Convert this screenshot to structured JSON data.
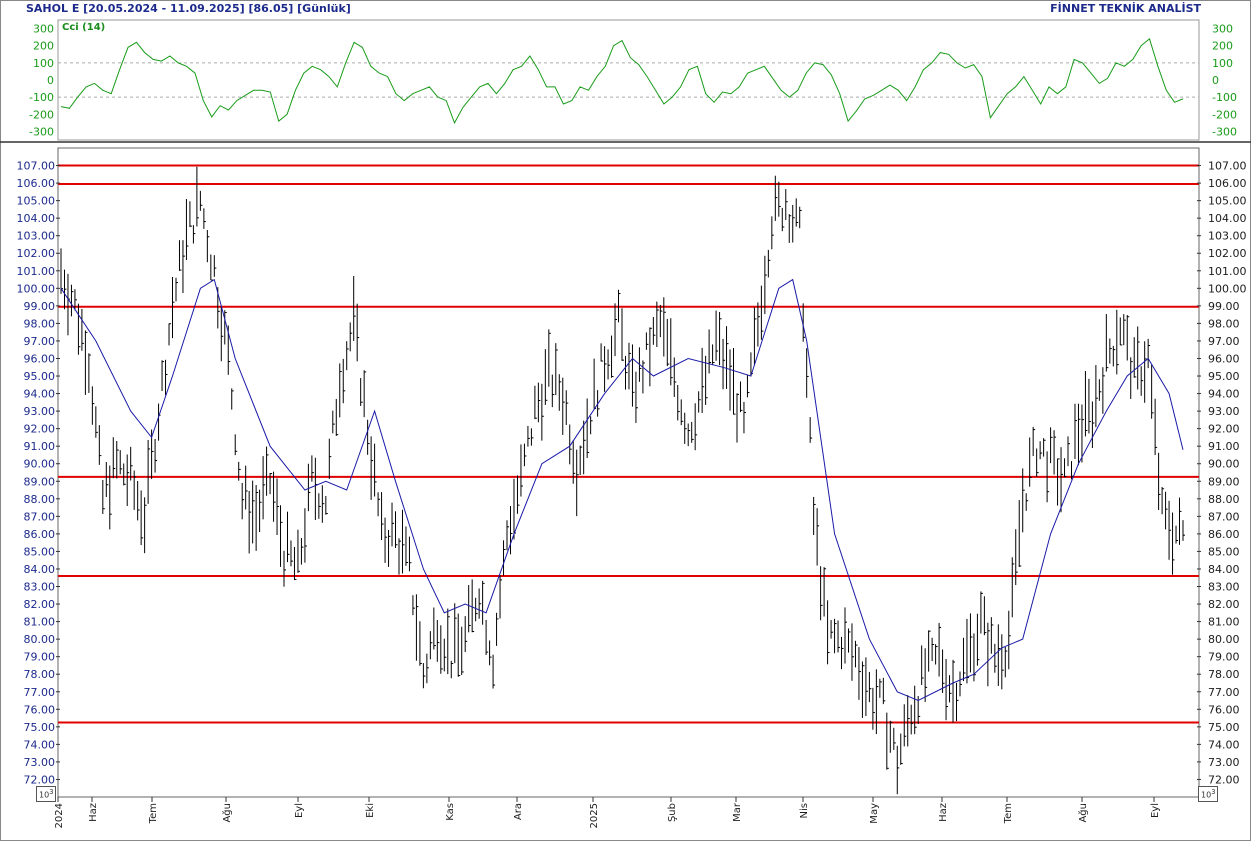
{
  "header": {
    "left": "SAHOL E  [20.05.2024 - 11.09.2025]  [86.05]  [Günlük]",
    "right": "FİNNET TEKNİK ANALİST"
  },
  "cci_label": "Cci (14)",
  "unit_label": "10^3",
  "colors": {
    "price": "#000000",
    "ma": "#1a1aa8",
    "cci": "#1a9c1a",
    "hline": "#e00000",
    "axis_text": "#1c2a8c",
    "tick_text": "#1c1c1c"
  },
  "chart_data": [
    {
      "type": "line",
      "indicator": "CCI",
      "label": "Cci (14)",
      "ylim": [
        -350,
        350
      ],
      "yticks": [
        300,
        200,
        100,
        0,
        -100,
        -200,
        -300
      ],
      "reference_lines": [
        100,
        -100
      ],
      "values": [
        -155,
        -165,
        -100,
        -40,
        -20,
        -60,
        -80,
        60,
        190,
        220,
        160,
        120,
        110,
        140,
        100,
        80,
        40,
        -120,
        -215,
        -150,
        -175,
        -120,
        -90,
        -60,
        -60,
        -70,
        -240,
        -200,
        -60,
        40,
        80,
        60,
        20,
        -40,
        100,
        220,
        190,
        80,
        40,
        20,
        -80,
        -120,
        -80,
        -60,
        -40,
        -100,
        -120,
        -250,
        -160,
        -100,
        -40,
        -20,
        -80,
        -20,
        60,
        80,
        140,
        60,
        -40,
        -40,
        -140,
        -120,
        -40,
        -60,
        20,
        80,
        200,
        230,
        130,
        90,
        20,
        -60,
        -140,
        -100,
        -40,
        60,
        80,
        -80,
        -130,
        -70,
        -80,
        -40,
        40,
        60,
        80,
        10,
        -60,
        -100,
        -60,
        40,
        100,
        90,
        30,
        -80,
        -240,
        -180,
        -110,
        -90,
        -60,
        -30,
        -60,
        -120,
        -40,
        60,
        100,
        160,
        150,
        100,
        70,
        90,
        20,
        -220,
        -150,
        -80,
        -40,
        20,
        -60,
        -140,
        -40,
        -80,
        -40,
        120,
        100,
        40,
        -20,
        10,
        100,
        80,
        120,
        200,
        240,
        80,
        -60,
        -130,
        -110
      ],
      "x_start": 61,
      "x_end": 1183
    },
    {
      "type": "ohlc",
      "title": "SAHOL E",
      "ylim": [
        71,
        108
      ],
      "yticks": [
        107,
        106,
        105,
        104,
        103,
        102,
        101,
        100,
        99,
        98,
        97,
        96,
        95,
        94,
        93,
        92,
        91,
        90,
        89,
        88,
        87,
        86,
        85,
        84,
        83,
        82,
        81,
        80,
        79,
        78,
        77,
        76,
        75,
        74,
        73,
        72
      ],
      "x_tick_labels": [
        "2024",
        "Haz",
        "Tem",
        "Ağu",
        "Eyl",
        "Eki",
        "Kas",
        "Ara",
        "2025",
        "Şub",
        "Mar",
        "Nis",
        "May",
        "Haz",
        "Tem",
        "Ağu",
        "Eyl"
      ],
      "horizontal_levels": [
        107.0,
        105.95,
        98.95,
        89.25,
        83.6,
        75.25
      ],
      "close_anchors": [
        [
          0,
          101
        ],
        [
          4,
          99
        ],
        [
          8,
          96
        ],
        [
          12,
          88
        ],
        [
          16,
          90
        ],
        [
          20,
          89
        ],
        [
          24,
          87
        ],
        [
          28,
          93
        ],
        [
          32,
          99
        ],
        [
          36,
          103
        ],
        [
          40,
          105
        ],
        [
          44,
          101
        ],
        [
          48,
          96
        ],
        [
          52,
          88
        ],
        [
          56,
          87
        ],
        [
          60,
          89
        ],
        [
          64,
          85
        ],
        [
          68,
          84
        ],
        [
          72,
          89
        ],
        [
          76,
          88
        ],
        [
          80,
          95
        ],
        [
          84,
          98
        ],
        [
          88,
          92
        ],
        [
          92,
          86
        ],
        [
          96,
          86
        ],
        [
          100,
          84
        ],
        [
          104,
          78
        ],
        [
          108,
          81
        ],
        [
          112,
          79
        ],
        [
          116,
          80
        ],
        [
          120,
          83
        ],
        [
          124,
          79
        ],
        [
          128,
          86
        ],
        [
          132,
          89
        ],
        [
          136,
          93
        ],
        [
          140,
          95
        ],
        [
          144,
          94
        ],
        [
          148,
          90
        ],
        [
          152,
          93
        ],
        [
          156,
          96
        ],
        [
          160,
          98
        ],
        [
          164,
          94
        ],
        [
          168,
          96
        ],
        [
          172,
          98
        ],
        [
          176,
          95
        ],
        [
          180,
          92
        ],
        [
          184,
          94
        ],
        [
          188,
          97
        ],
        [
          192,
          95
        ],
        [
          196,
          92
        ],
        [
          200,
          98
        ],
        [
          204,
          104
        ],
        [
          208,
          105
        ],
        [
          212,
          103
        ],
        [
          216,
          87
        ],
        [
          220,
          80
        ],
        [
          224,
          80
        ],
        [
          228,
          79
        ],
        [
          232,
          77
        ],
        [
          236,
          76
        ],
        [
          240,
          73
        ],
        [
          244,
          76
        ],
        [
          248,
          78
        ],
        [
          252,
          79
        ],
        [
          256,
          77
        ],
        [
          260,
          79
        ],
        [
          264,
          81
        ],
        [
          268,
          79
        ],
        [
          272,
          80
        ],
        [
          276,
          88
        ],
        [
          280,
          91
        ],
        [
          284,
          90
        ],
        [
          288,
          89
        ],
        [
          292,
          92
        ],
        [
          296,
          93
        ],
        [
          300,
          96
        ],
        [
          304,
          98
        ],
        [
          308,
          95
        ],
        [
          312,
          96
        ],
        [
          316,
          87
        ],
        [
          320,
          86
        ],
        [
          322,
          86
        ]
      ],
      "moving_average": [
        [
          0,
          100
        ],
        [
          10,
          97
        ],
        [
          20,
          93
        ],
        [
          26,
          91.5
        ],
        [
          32,
          95
        ],
        [
          40,
          100
        ],
        [
          44,
          100.5
        ],
        [
          50,
          96
        ],
        [
          60,
          91
        ],
        [
          70,
          88.5
        ],
        [
          76,
          89
        ],
        [
          82,
          88.5
        ],
        [
          90,
          93
        ],
        [
          96,
          89
        ],
        [
          104,
          84
        ],
        [
          110,
          81.5
        ],
        [
          116,
          82
        ],
        [
          122,
          81.5
        ],
        [
          130,
          86
        ],
        [
          138,
          90
        ],
        [
          146,
          91
        ],
        [
          156,
          94
        ],
        [
          164,
          96
        ],
        [
          170,
          95
        ],
        [
          180,
          96
        ],
        [
          190,
          95.5
        ],
        [
          198,
          95
        ],
        [
          206,
          100
        ],
        [
          210,
          100.5
        ],
        [
          214,
          97
        ],
        [
          222,
          86
        ],
        [
          232,
          80
        ],
        [
          240,
          77
        ],
        [
          246,
          76.5
        ],
        [
          256,
          77.5
        ],
        [
          262,
          78
        ],
        [
          270,
          79.5
        ],
        [
          276,
          80
        ],
        [
          284,
          86
        ],
        [
          292,
          90
        ],
        [
          300,
          93
        ],
        [
          306,
          95
        ],
        [
          312,
          96
        ],
        [
          318,
          94
        ],
        [
          322,
          90.8
        ]
      ]
    }
  ]
}
